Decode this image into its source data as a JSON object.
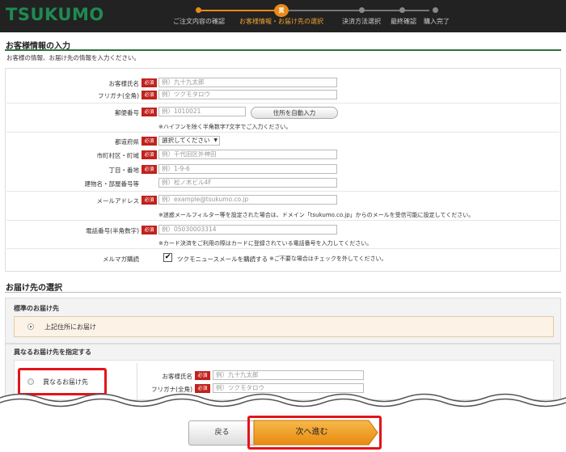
{
  "header": {
    "logo": "TSUKUMO",
    "steps": [
      {
        "label": "ご注文内容の確認",
        "state": "done"
      },
      {
        "label": "お客様情報・お届け先の選択",
        "state": "current"
      },
      {
        "label": "決済方法選択",
        "state": "todo"
      },
      {
        "label": "最終確認",
        "state": "todo"
      },
      {
        "label": "購入完了",
        "state": "todo"
      }
    ],
    "current_badge": "買",
    "accent": "#e88a1a"
  },
  "customer": {
    "title": "お客様情報の入力",
    "desc": "お客様の情報、お届け先の情報を入力ください。",
    "required_badge": "必須",
    "fields": {
      "name": {
        "label": "お客様氏名",
        "placeholder": "例）九十九太郎"
      },
      "kana": {
        "label": "フリガナ(全角)",
        "placeholder": "例）ツクモタロウ"
      },
      "zip": {
        "label": "郵便番号",
        "placeholder": "例）1010021",
        "button": "住所を自動入力",
        "hint": "※ハイフンを除く半角数字7文字でご入力ください。"
      },
      "pref": {
        "label": "都道府県",
        "value": "選択してください"
      },
      "city": {
        "label": "市町村区・町域",
        "placeholder": "例）千代田区外神田"
      },
      "block": {
        "label": "丁目・番地",
        "placeholder": "例）1-9-6"
      },
      "building": {
        "label": "建物名・部屋番号等",
        "placeholder": "例）松ノ木ビル4F"
      },
      "email": {
        "label": "メールアドレス",
        "placeholder": "例）example@tsukumo.co.jp",
        "hint": "※迷惑メールフィルター等を設定された場合は、ドメイン「tsukumo.co.jp」からのメールを受信可能に設定してください。"
      },
      "phone": {
        "label": "電話番号(半角数字)",
        "placeholder": "例）05030003314",
        "hint": "※カード決済をご利用の際はカードに登録されている電話番号を入力してください。"
      },
      "mail_magazine": {
        "label": "メルマガ購読",
        "check_label": "ツクモニュースメールを購読する",
        "note": "※ご不要な場合はチェックを外してください。",
        "checked": true
      }
    }
  },
  "delivery": {
    "title": "お届け先の選択",
    "standard": {
      "title": "標準のお届け先",
      "option": "上記住所にお届け"
    },
    "different": {
      "title": "異なるお届け先を指定する",
      "option": "異なるお届け先",
      "name_label": "お客様氏名",
      "name_placeholder": "例）九十九太郎",
      "kana_label": "フリガナ(全角)",
      "kana_placeholder": "例）ツクモタロウ"
    }
  },
  "actions": {
    "back": "戻る",
    "next": "次へ進む",
    "highlight_color": "#e3141a"
  }
}
